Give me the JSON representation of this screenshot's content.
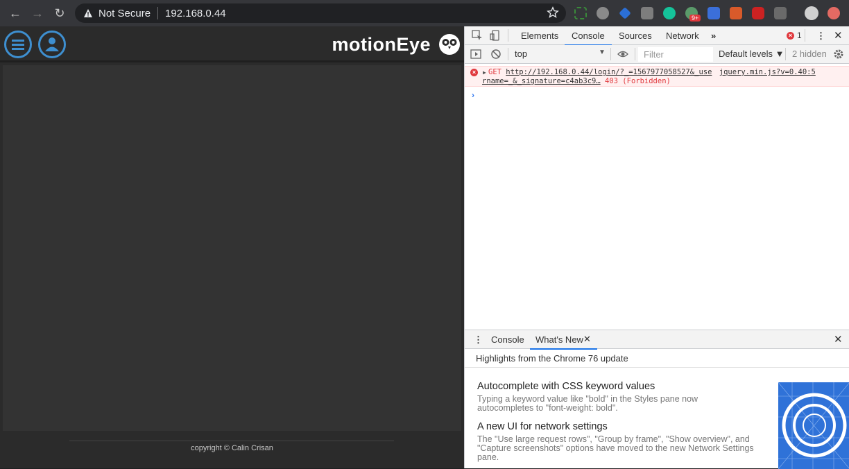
{
  "browser": {
    "security_label": "Not Secure",
    "url": "192.168.0.44",
    "badge_count": "9+"
  },
  "motioneye": {
    "logo_text": "motionEye",
    "footer_text": "copyright © Calin Crisan"
  },
  "devtools": {
    "tabs": [
      "Elements",
      "Console",
      "Sources",
      "Network"
    ],
    "active_tab": "Console",
    "error_count": "1",
    "context": "top",
    "filter_placeholder": "Filter",
    "levels": "Default levels ▼",
    "hidden_count": "2 hidden",
    "error_message": {
      "method": "GET",
      "url": "http://192.168.0.44/login/?_=1567977058527&_use",
      "source": "jquery.min.js?v=0.40:5",
      "url_cont": "rname=_&_signature=c4ab3c9…",
      "status": "403 (Forbidden)"
    },
    "drawer": {
      "tabs": [
        "Console",
        "What's New"
      ],
      "active_tab": "What's New",
      "highlights": "Highlights from the Chrome 76 update",
      "features": [
        {
          "title": "Autocomplete with CSS keyword values",
          "desc": "Typing a keyword value like \"bold\" in the Styles pane now autocompletes to \"font-weight: bold\"."
        },
        {
          "title": "A new UI for network settings",
          "desc": "The \"Use large request rows\", \"Group by frame\", \"Show overview\", and \"Capture screenshots\" options have moved to the new Network Settings pane."
        }
      ]
    }
  },
  "colors": {
    "motioneye_accent": "#3e8fd0",
    "devtools_active": "#1a73e8",
    "error_red": "#e0393e"
  }
}
